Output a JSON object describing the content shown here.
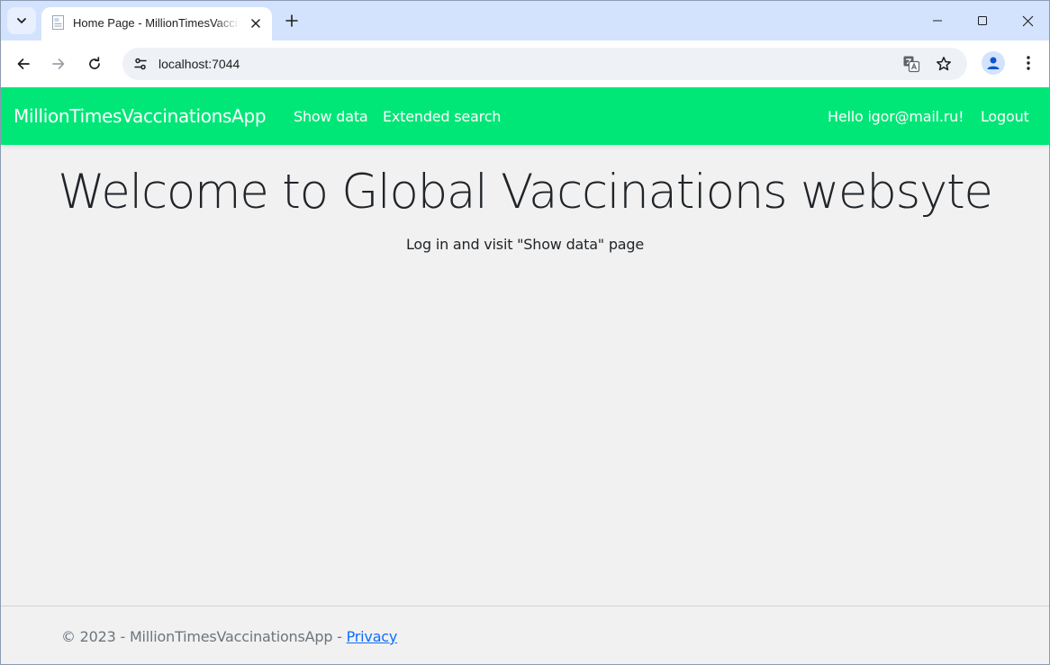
{
  "browser": {
    "tab": {
      "title": "Home Page - MillionTimesVaccinationsApp",
      "favicon": "document-icon"
    },
    "address_bar": {
      "url": "localhost:7044"
    },
    "icons": {
      "tab_search": "chevron-down-icon",
      "close_tab": "close-icon",
      "new_tab": "plus-icon",
      "back": "arrow-left-icon",
      "forward": "arrow-right-icon",
      "reload": "reload-icon",
      "site_info": "tune-icon",
      "translate": "translate-icon",
      "bookmark": "star-icon",
      "profile": "person-icon",
      "menu": "more-vert-icon",
      "minimize": "minimize-icon",
      "maximize": "maximize-icon",
      "close_window": "close-icon"
    }
  },
  "navbar": {
    "brand": "MillionTimesVaccinationsApp",
    "links": [
      "Show data",
      "Extended search"
    ],
    "user_greeting": "Hello igor@mail.ru!",
    "logout": "Logout",
    "background_color": "#00e777"
  },
  "main": {
    "heading": "Welcome to Global Vaccinations websyte",
    "subtext": "Log in and visit \"Show data\" page"
  },
  "footer": {
    "copyright": "© 2023 - MillionTimesVaccinationsApp - ",
    "privacy_link": "Privacy"
  }
}
